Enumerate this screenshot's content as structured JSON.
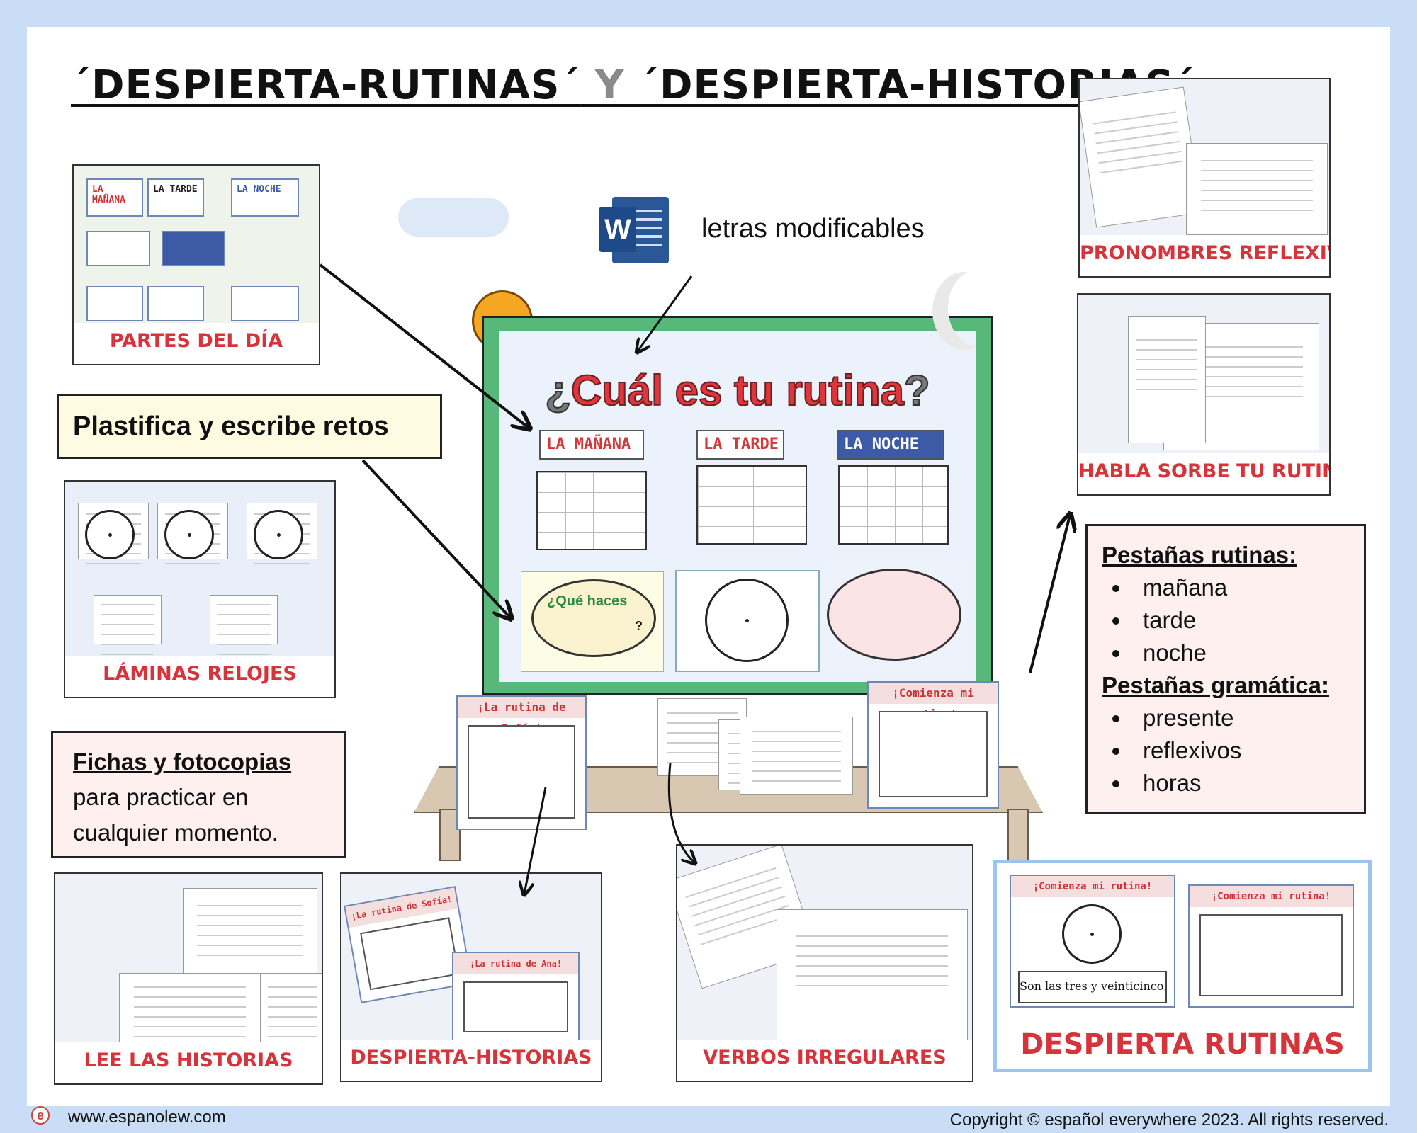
{
  "title": {
    "part1": "´DESPIERTA-RUTINAS´",
    "part2": "Y",
    "part3": "´DESPIERTA-HISTORIAS´"
  },
  "word_note": "letras modificables",
  "word_icon_letter": "W",
  "board": {
    "q_open": "¿",
    "title": "Cuál es tu rutina",
    "q_close": "?",
    "tags": [
      "LA MAÑANA",
      "LA TARDE",
      "LA NOCHE"
    ],
    "bubble_text": "¿Qué haces",
    "bubble_mark": "?"
  },
  "callouts": {
    "plastifica": "Plastifica y escribe retos",
    "fichas_title": "Fichas y fotocopias",
    "fichas_line1": "para practicar en",
    "fichas_line2": "cualquier momento.",
    "pest_rutinas_title": "Pestañas rutinas:",
    "pest_rutinas": [
      "mañana",
      "tarde",
      "noche"
    ],
    "pest_gram_title": "Pestañas gramática:",
    "pest_gram": [
      "presente",
      "reflexivos",
      "horas"
    ]
  },
  "cards": {
    "partes": "PARTES DEL DÍA",
    "laminas": "LÁMINAS RELOJES",
    "pronombres": "PRONOMBRES REFLEXIVOS",
    "habla": "HABLA SORBE TU RUTINA",
    "lee": "LEE LAS HISTORIAS",
    "dhistorias": "DESPIERTA-HISTORIAS",
    "verbos": "VERBOS IRREGULARES",
    "drutinas": "DESPIERTA RUTINAS"
  },
  "partes_tags": [
    "LA MAÑANA",
    "LA TARDE",
    "LA NOCHE"
  ],
  "fold_titles": {
    "sofia": "¡La rutina de Sofía!",
    "comienza": "¡Comienza mi rutina!",
    "ana": "¡La rutina de Ana!"
  },
  "dr_caption_inner": "Son las tres y veinticinco.",
  "footer": {
    "site": "www.espanolew.com",
    "copyright": "Copyright © español everywhere 2023. All rights reserved.",
    "logo": "e"
  },
  "colors": {
    "accent_red": "#d6343a",
    "board_green": "#58b879",
    "frame_blue": "#c9ddf7"
  }
}
